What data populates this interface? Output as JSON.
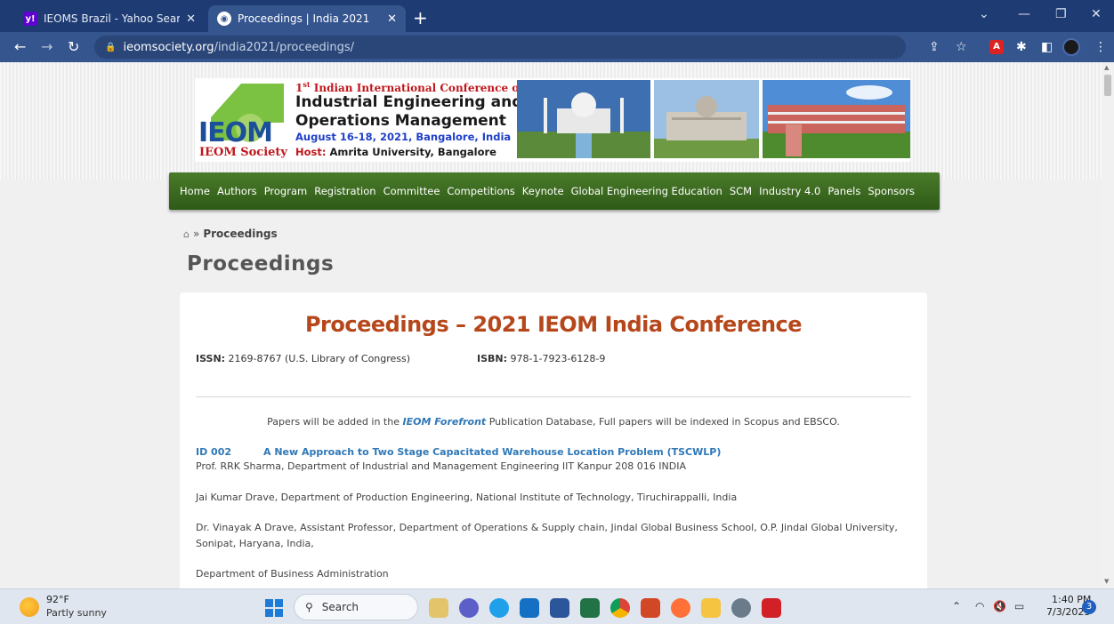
{
  "browser": {
    "tabs": [
      {
        "title": "IEOMS Brazil - Yahoo Search Resu",
        "favicon": "Y"
      },
      {
        "title": "Proceedings | India 2021",
        "favicon": "globe"
      }
    ],
    "url_host": "ieomsociety.org",
    "url_path": "/india2021/proceedings/"
  },
  "banner": {
    "line1_prefix": "1",
    "line1_sup": "st",
    "line1_rest": " Indian International Conference on",
    "line2": "Industrial Engineering and",
    "line3": "Operations Management",
    "line4": "August 16-18, 2021, Bangalore, India",
    "ieom_logo": "IEOM",
    "society": "IEOM Society",
    "host_label": "Host:",
    "host_name": " Amrita University, Bangalore"
  },
  "menu": [
    "Home",
    "Authors",
    "Program",
    "Registration",
    "Committee",
    "Competitions",
    "Keynote",
    "Global Engineering Education",
    "SCM",
    "Industry 4.0",
    "Panels",
    "Sponsors"
  ],
  "breadcrumb": {
    "sep": "»",
    "current": "Proceedings"
  },
  "page_title": "Proceedings",
  "card": {
    "title": "Proceedings – 2021 IEOM India Conference",
    "issn_label": "ISSN:",
    "issn_value": " 2169-8767 (U.S. Library of Congress)",
    "isbn_label": "ISBN:",
    "isbn_value": " 978-1-7923-6128-9",
    "notice_pre": "Papers will be added in the ",
    "notice_em": "IEOM Forefront",
    "notice_post": " Publication Database,  Full papers will be indexed in Scopus and EBSCO.",
    "paper": {
      "id": "ID 002",
      "title": "A New Approach to Two Stage Capacitated Warehouse Location Problem (TSCWLP)",
      "authors": [
        "Prof. RRK Sharma, Department of Industrial and Management Engineering IIT Kanpur 208 016 INDIA",
        "Jai Kumar Drave, Department of Production Engineering, National Institute of Technology, Tiruchirappalli, India",
        "Dr. Vinayak A Drave, Assistant Professor, Department of Operations & Supply chain, Jindal Global Business School, O.P. Jindal Global University, Sonipat, Haryana, India,",
        "Department of Business Administration"
      ]
    }
  },
  "taskbar": {
    "temp": "92°F",
    "weather": "Partly sunny",
    "search_label": "Search",
    "time": "1:40 PM",
    "date": "7/3/2023",
    "notifications": "3"
  },
  "colors": {
    "tab_bar": "#1f3b73",
    "address_bar": "#35558f",
    "menu_green": "#3b6b22",
    "title_orange": "#b5471b",
    "link_blue": "#2f78b7"
  }
}
